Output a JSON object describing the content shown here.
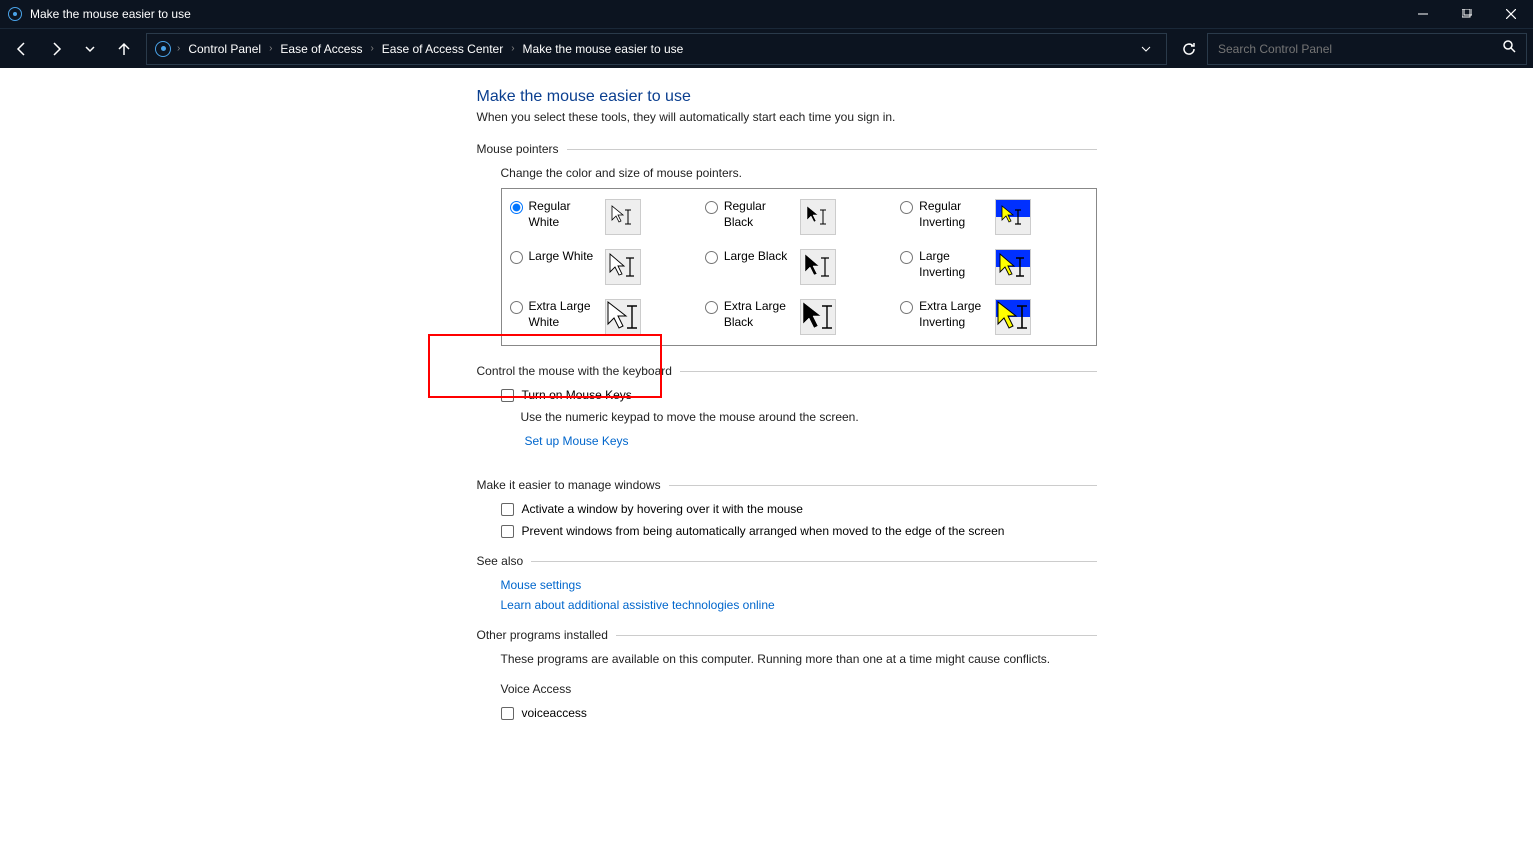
{
  "window": {
    "title": "Make the mouse easier to use"
  },
  "breadcrumb": {
    "items": [
      "Control Panel",
      "Ease of Access",
      "Ease of Access Center",
      "Make the mouse easier to use"
    ]
  },
  "search": {
    "placeholder": "Search Control Panel"
  },
  "page": {
    "title": "Make the mouse easier to use",
    "subtitle": "When you select these tools, they will automatically start each time you sign in."
  },
  "sections": {
    "mouse_pointers": {
      "header": "Mouse pointers",
      "desc": "Change the color and size of mouse pointers.",
      "options": [
        {
          "label": "Regular White",
          "checked": true
        },
        {
          "label": "Regular Black",
          "checked": false
        },
        {
          "label": "Regular Inverting",
          "checked": false
        },
        {
          "label": "Large White",
          "checked": false
        },
        {
          "label": "Large Black",
          "checked": false
        },
        {
          "label": "Large Inverting",
          "checked": false
        },
        {
          "label": "Extra Large White",
          "checked": false
        },
        {
          "label": "Extra Large Black",
          "checked": false
        },
        {
          "label": "Extra Large Inverting",
          "checked": false
        }
      ]
    },
    "keyboard": {
      "header": "Control the mouse with the keyboard",
      "checkbox": "Turn on Mouse Keys",
      "desc": "Use the numeric keypad to move the mouse around the screen.",
      "link": "Set up Mouse Keys"
    },
    "windows": {
      "header": "Make it easier to manage windows",
      "checkbox1": "Activate a window by hovering over it with the mouse",
      "checkbox2": "Prevent windows from being automatically arranged when moved to the edge of the screen"
    },
    "see_also": {
      "header": "See also",
      "link1": "Mouse settings",
      "link2": "Learn about additional assistive technologies online"
    },
    "other": {
      "header": "Other programs installed",
      "desc": "These programs are available on this computer. Running more than one at a time might cause conflicts.",
      "voice_label": "Voice Access",
      "voice_checkbox": "voiceaccess"
    }
  }
}
